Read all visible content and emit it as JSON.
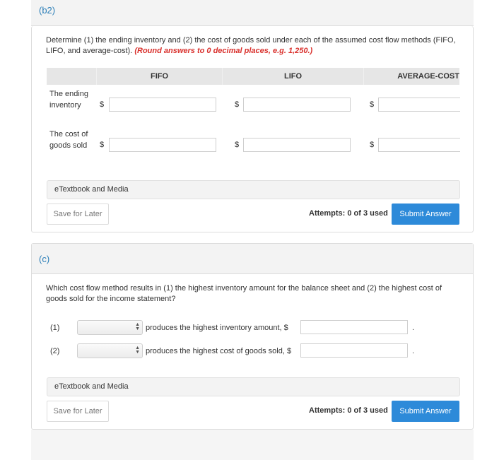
{
  "section_b2": {
    "label": "(b2)",
    "question": "Determine (1) the ending inventory and (2) the cost of goods sold under each of the assumed cost flow methods (FIFO, LIFO, and average-cost).",
    "hint": "(Round answers to 0 decimal places, e.g. 1,250.)",
    "columns": [
      "FIFO",
      "LIFO",
      "AVERAGE-COST"
    ],
    "rows": [
      {
        "label": "The ending inventory",
        "currency": "$",
        "values": [
          "",
          "",
          ""
        ]
      },
      {
        "label": "The cost of goods sold",
        "currency": "$",
        "values": [
          "",
          "",
          ""
        ]
      }
    ],
    "etextbook_label": "eTextbook and Media",
    "save_label": "Save for Later",
    "attempts_label": "Attempts: 0 of 3 used",
    "submit_label": "Submit Answer"
  },
  "section_c": {
    "label": "(c)",
    "question": "Which cost flow method results in (1) the highest inventory amount for the balance sheet and (2) the highest cost of goods sold for the income statement?",
    "items": [
      {
        "number": "(1)",
        "selected": "",
        "text": "produces the highest inventory amount, $",
        "value": "",
        "suffix": "."
      },
      {
        "number": "(2)",
        "selected": "",
        "text": "produces the highest cost of goods sold, $",
        "value": "",
        "suffix": "."
      }
    ],
    "etextbook_label": "eTextbook and Media",
    "save_label": "Save for Later",
    "attempts_label": "Attempts: 0 of 3 used",
    "submit_label": "Submit Answer"
  },
  "colors": {
    "accent": "#2d8ad9",
    "section_label": "#2c7fb8",
    "hint": "#d9302c"
  }
}
